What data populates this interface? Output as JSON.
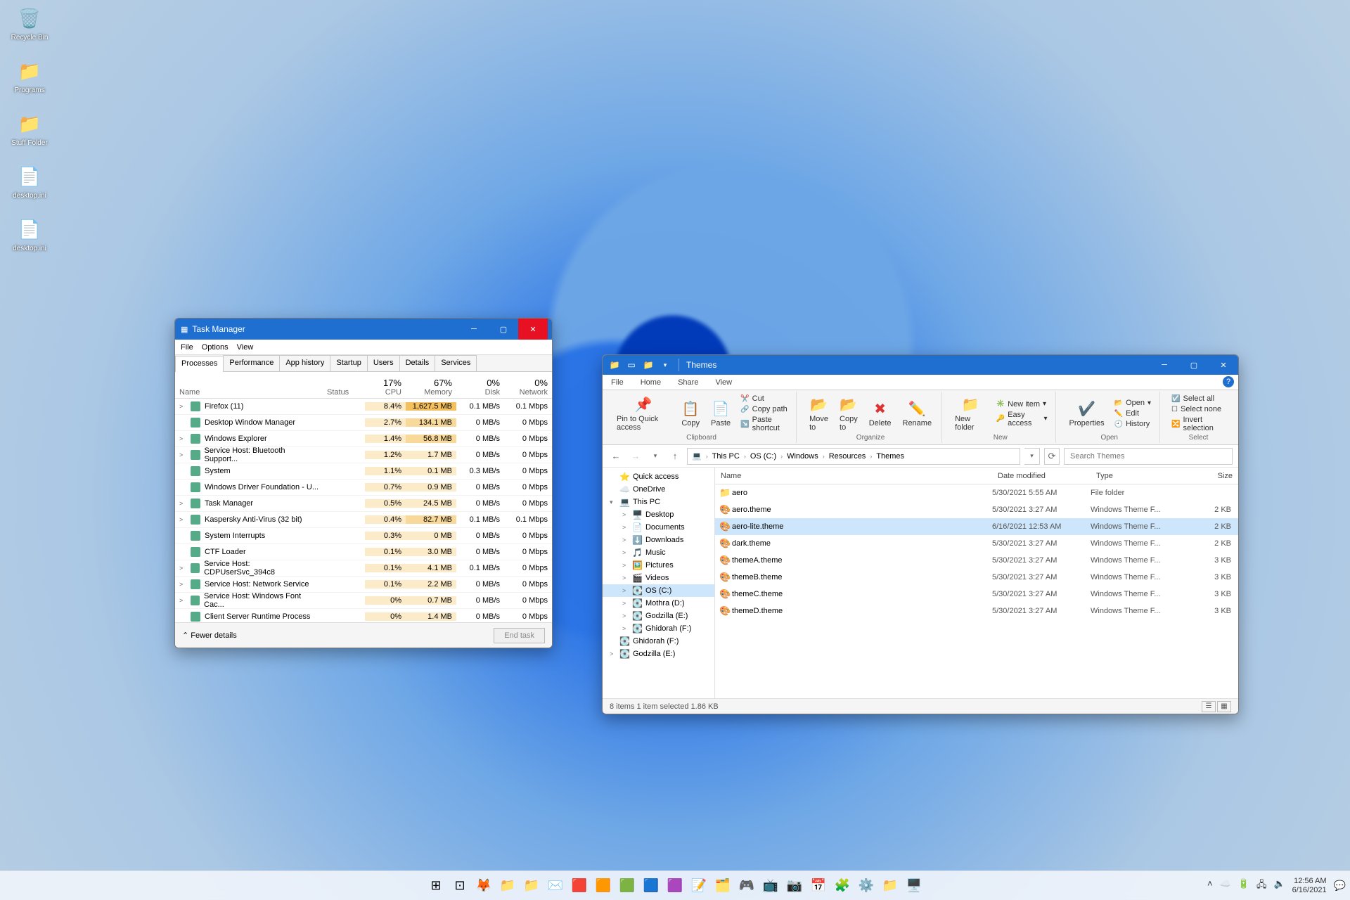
{
  "desktop_icons": [
    {
      "label": "Recycle Bin",
      "glyph": "🗑️"
    },
    {
      "label": "Programs",
      "glyph": "📁"
    },
    {
      "label": "Stuff Folder",
      "glyph": "📁"
    },
    {
      "label": "desktop.ini",
      "glyph": "📄"
    },
    {
      "label": "desktop.ini",
      "glyph": "📄"
    }
  ],
  "task_manager": {
    "title": "Task Manager",
    "menu": [
      "File",
      "Options",
      "View"
    ],
    "tabs": [
      "Processes",
      "Performance",
      "App history",
      "Startup",
      "Users",
      "Details",
      "Services"
    ],
    "active_tab": 0,
    "columns": {
      "name": "Name",
      "status": "Status",
      "cpu_pct": "17%",
      "cpu_lbl": "CPU",
      "mem_pct": "67%",
      "mem_lbl": "Memory",
      "disk_pct": "0%",
      "disk_lbl": "Disk",
      "net_pct": "0%",
      "net_lbl": "Network"
    },
    "rows": [
      {
        "exp": ">",
        "name": "Firefox (11)",
        "cpu": "8.4%",
        "mem": "1,627.5 MB",
        "disk": "0.1 MB/s",
        "net": "0.1 Mbps"
      },
      {
        "exp": "",
        "name": "Desktop Window Manager",
        "cpu": "2.7%",
        "mem": "134.1 MB",
        "disk": "0 MB/s",
        "net": "0 Mbps"
      },
      {
        "exp": ">",
        "name": "Windows Explorer",
        "cpu": "1.4%",
        "mem": "56.8 MB",
        "disk": "0 MB/s",
        "net": "0 Mbps"
      },
      {
        "exp": ">",
        "name": "Service Host: Bluetooth Support...",
        "cpu": "1.2%",
        "mem": "1.7 MB",
        "disk": "0 MB/s",
        "net": "0 Mbps"
      },
      {
        "exp": "",
        "name": "System",
        "cpu": "1.1%",
        "mem": "0.1 MB",
        "disk": "0.3 MB/s",
        "net": "0 Mbps"
      },
      {
        "exp": "",
        "name": "Windows Driver Foundation - U...",
        "cpu": "0.7%",
        "mem": "0.9 MB",
        "disk": "0 MB/s",
        "net": "0 Mbps"
      },
      {
        "exp": ">",
        "name": "Task Manager",
        "cpu": "0.5%",
        "mem": "24.5 MB",
        "disk": "0 MB/s",
        "net": "0 Mbps"
      },
      {
        "exp": ">",
        "name": "Kaspersky Anti-Virus (32 bit)",
        "cpu": "0.4%",
        "mem": "82.7 MB",
        "disk": "0.1 MB/s",
        "net": "0.1 Mbps"
      },
      {
        "exp": "",
        "name": "System Interrupts",
        "cpu": "0.3%",
        "mem": "0 MB",
        "disk": "0 MB/s",
        "net": "0 Mbps"
      },
      {
        "exp": "",
        "name": "CTF Loader",
        "cpu": "0.1%",
        "mem": "3.0 MB",
        "disk": "0 MB/s",
        "net": "0 Mbps"
      },
      {
        "exp": ">",
        "name": "Service Host: CDPUserSvc_394c8",
        "cpu": "0.1%",
        "mem": "4.1 MB",
        "disk": "0.1 MB/s",
        "net": "0 Mbps"
      },
      {
        "exp": ">",
        "name": "Service Host: Network Service",
        "cpu": "0.1%",
        "mem": "2.2 MB",
        "disk": "0 MB/s",
        "net": "0 Mbps"
      },
      {
        "exp": ">",
        "name": "Service Host: Windows Font Cac...",
        "cpu": "0%",
        "mem": "0.7 MB",
        "disk": "0 MB/s",
        "net": "0 Mbps"
      },
      {
        "exp": "",
        "name": "Client Server Runtime Process",
        "cpu": "0%",
        "mem": "1.4 MB",
        "disk": "0 MB/s",
        "net": "0 Mbps"
      }
    ],
    "footer": {
      "fewer": "Fewer details",
      "end_task": "End task"
    }
  },
  "explorer": {
    "title": "Themes",
    "ribbon_tabs": [
      "File",
      "Home",
      "Share",
      "View"
    ],
    "active_ribbon_tab": 1,
    "ribbon": {
      "clipboard": {
        "label": "Clipboard",
        "pin": "Pin to Quick access",
        "copy": "Copy",
        "paste": "Paste",
        "cut": "Cut",
        "copy_path": "Copy path",
        "paste_shortcut": "Paste shortcut"
      },
      "organize": {
        "label": "Organize",
        "move_to": "Move to",
        "copy_to": "Copy to",
        "delete": "Delete",
        "rename": "Rename"
      },
      "new": {
        "label": "New",
        "new_folder": "New folder",
        "new_item": "New item",
        "easy_access": "Easy access"
      },
      "open": {
        "label": "Open",
        "properties": "Properties",
        "open": "Open",
        "edit": "Edit",
        "history": "History"
      },
      "select": {
        "label": "Select",
        "select_all": "Select all",
        "select_none": "Select none",
        "invert": "Invert selection"
      }
    },
    "breadcrumb": [
      "This PC",
      "OS (C:)",
      "Windows",
      "Resources",
      "Themes"
    ],
    "search_placeholder": "Search Themes",
    "tree": [
      {
        "level": 0,
        "chv": "",
        "icon": "⭐",
        "label": "Quick access"
      },
      {
        "level": 0,
        "chv": "",
        "icon": "☁️",
        "label": "OneDrive"
      },
      {
        "level": 0,
        "chv": "▾",
        "icon": "💻",
        "label": "This PC"
      },
      {
        "level": 1,
        "chv": ">",
        "icon": "🖥️",
        "label": "Desktop"
      },
      {
        "level": 1,
        "chv": ">",
        "icon": "📄",
        "label": "Documents"
      },
      {
        "level": 1,
        "chv": ">",
        "icon": "⬇️",
        "label": "Downloads"
      },
      {
        "level": 1,
        "chv": ">",
        "icon": "🎵",
        "label": "Music"
      },
      {
        "level": 1,
        "chv": ">",
        "icon": "🖼️",
        "label": "Pictures"
      },
      {
        "level": 1,
        "chv": ">",
        "icon": "🎬",
        "label": "Videos"
      },
      {
        "level": 1,
        "chv": ">",
        "icon": "💽",
        "label": "OS (C:)",
        "selected": true
      },
      {
        "level": 1,
        "chv": ">",
        "icon": "💽",
        "label": "Mothra (D:)"
      },
      {
        "level": 1,
        "chv": ">",
        "icon": "💽",
        "label": "Godzilla (E:)"
      },
      {
        "level": 1,
        "chv": ">",
        "icon": "💽",
        "label": "Ghidorah (F:)"
      },
      {
        "level": 0,
        "chv": "",
        "icon": "💽",
        "label": "Ghidorah (F:)"
      },
      {
        "level": 0,
        "chv": ">",
        "icon": "💽",
        "label": "Godzilla (E:)"
      }
    ],
    "list_columns": {
      "name": "Name",
      "date": "Date modified",
      "type": "Type",
      "size": "Size"
    },
    "files": [
      {
        "icon": "📁",
        "name": "aero",
        "date": "5/30/2021 5:55 AM",
        "type": "File folder",
        "size": ""
      },
      {
        "icon": "🎨",
        "name": "aero.theme",
        "date": "5/30/2021 3:27 AM",
        "type": "Windows Theme F...",
        "size": "2 KB"
      },
      {
        "icon": "🎨",
        "name": "aero-lite.theme",
        "date": "6/16/2021 12:53 AM",
        "type": "Windows Theme F...",
        "size": "2 KB",
        "selected": true
      },
      {
        "icon": "🎨",
        "name": "dark.theme",
        "date": "5/30/2021 3:27 AM",
        "type": "Windows Theme F...",
        "size": "2 KB"
      },
      {
        "icon": "🎨",
        "name": "themeA.theme",
        "date": "5/30/2021 3:27 AM",
        "type": "Windows Theme F...",
        "size": "3 KB"
      },
      {
        "icon": "🎨",
        "name": "themeB.theme",
        "date": "5/30/2021 3:27 AM",
        "type": "Windows Theme F...",
        "size": "3 KB"
      },
      {
        "icon": "🎨",
        "name": "themeC.theme",
        "date": "5/30/2021 3:27 AM",
        "type": "Windows Theme F...",
        "size": "3 KB"
      },
      {
        "icon": "🎨",
        "name": "themeD.theme",
        "date": "5/30/2021 3:27 AM",
        "type": "Windows Theme F...",
        "size": "3 KB"
      }
    ],
    "status_left": "8 items    1 item selected  1.86 KB"
  },
  "taskbar": {
    "apps": [
      "⊞",
      "⊡",
      "🦊",
      "📁",
      "📁",
      "✉️",
      "🟥",
      "🟧",
      "🟩",
      "🟦",
      "🟪",
      "📝",
      "🗂️",
      "🎮",
      "📺",
      "📷",
      "📅",
      "🧩",
      "⚙️",
      "📁",
      "🖥️"
    ],
    "tray": [
      "˄",
      "☁️",
      "🔋",
      "🖧",
      "🔈"
    ],
    "time": "12:56 AM",
    "date": "6/16/2021"
  }
}
